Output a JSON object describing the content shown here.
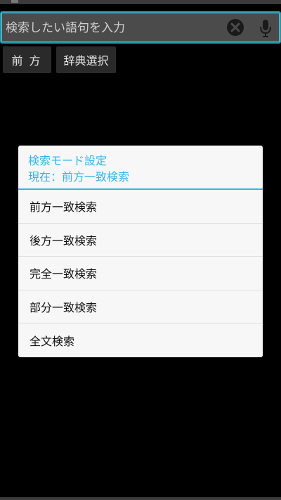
{
  "search": {
    "placeholder": "検索したい語句を入力",
    "clear_icon": "close-circle-icon",
    "mic_icon": "microphone-icon"
  },
  "toolbar": {
    "prefix_label": "前方",
    "dict_label": "辞典選択"
  },
  "dialog": {
    "title": "検索モード設定",
    "current": "現在：前方一致検索",
    "options": [
      "前方一致検索",
      "後方一致検索",
      "完全一致検索",
      "部分一致検索",
      "全文検索"
    ]
  },
  "colors": {
    "accent": "#33b5e5",
    "dialog_bg": "#f7f7f7",
    "background": "#000000"
  }
}
